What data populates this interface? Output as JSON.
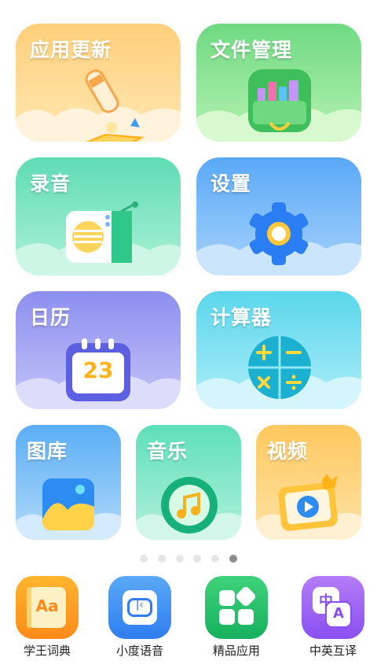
{
  "grid": {
    "tiles": [
      {
        "label": "应用更新",
        "icon": "rocket-book-icon",
        "color_top": "#ffcf7a",
        "color_bottom": "#ffe7b3"
      },
      {
        "label": "文件管理",
        "icon": "file-basket-icon",
        "color_top": "#6fd982",
        "color_bottom": "#b6f2b2"
      },
      {
        "label": "录音",
        "icon": "radio-recorder-icon",
        "color_top": "#5fdcb4",
        "color_bottom": "#aef1d8"
      },
      {
        "label": "设置",
        "icon": "gear-icon",
        "color_top": "#5aa9f7",
        "color_bottom": "#a7d2fb"
      },
      {
        "label": "日历",
        "icon": "calendar-icon",
        "color_top": "#8d8ff0",
        "color_bottom": "#c4c4f8",
        "calendar_day": "23"
      },
      {
        "label": "计算器",
        "icon": "calculator-icon",
        "color_top": "#5bd6ec",
        "color_bottom": "#aeeef8"
      },
      {
        "label": "图库",
        "icon": "gallery-icon",
        "color_top": "#5aaef6",
        "color_bottom": "#b2daf9"
      },
      {
        "label": "音乐",
        "icon": "music-disc-icon",
        "color_top": "#5edfb8",
        "color_bottom": "#b2f1dc"
      },
      {
        "label": "视频",
        "icon": "video-crown-icon",
        "color_top": "#ffc85e",
        "color_bottom": "#ffe2a6"
      }
    ]
  },
  "pager": {
    "count": 6,
    "active_index": 5
  },
  "dock": {
    "items": [
      {
        "label": "学王词典",
        "icon": "dictionary-icon",
        "glyph": "Aa"
      },
      {
        "label": "小度语音",
        "icon": "voice-assistant-icon"
      },
      {
        "label": "精品应用",
        "icon": "app-store-icon"
      },
      {
        "label": "中英互译",
        "icon": "translate-icon",
        "glyph_a": "中",
        "glyph_b": "A"
      }
    ]
  }
}
